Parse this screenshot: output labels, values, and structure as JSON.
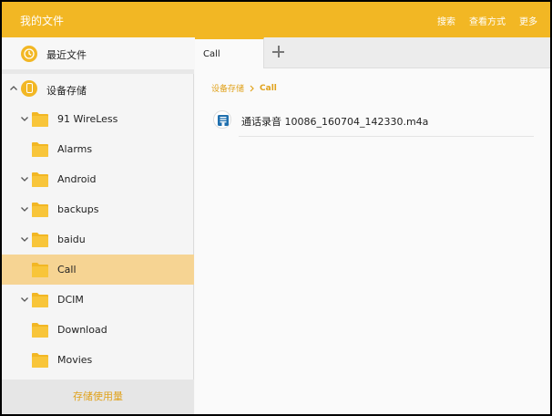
{
  "appbar": {
    "title": "我的文件",
    "actions": [
      "搜索",
      "查看方式",
      "更多"
    ]
  },
  "sidebar": {
    "recent_label": "最近文件",
    "device_label": "设备存储",
    "folders": [
      {
        "label": "91 WireLess",
        "expandable": true,
        "active": false
      },
      {
        "label": "Alarms",
        "expandable": false,
        "active": false
      },
      {
        "label": "Android",
        "expandable": true,
        "active": false
      },
      {
        "label": "backups",
        "expandable": true,
        "active": false
      },
      {
        "label": "baidu",
        "expandable": true,
        "active": false
      },
      {
        "label": "Call",
        "expandable": false,
        "active": true
      },
      {
        "label": "DCIM",
        "expandable": true,
        "active": false
      },
      {
        "label": "Download",
        "expandable": false,
        "active": false
      },
      {
        "label": "Movies",
        "expandable": false,
        "active": false
      }
    ],
    "storage_usage_label": "存储使用量"
  },
  "main": {
    "tabs": [
      {
        "label": "Call"
      }
    ],
    "breadcrumb": {
      "root": "设备存储",
      "current": "Call"
    },
    "files": [
      {
        "name": "通话录音 10086_160704_142330.m4a",
        "icon": "audio-file-icon"
      }
    ]
  },
  "colors": {
    "accent": "#f2b724",
    "active_row": "#f6d493",
    "breadcrumb": "#e0a21c"
  }
}
